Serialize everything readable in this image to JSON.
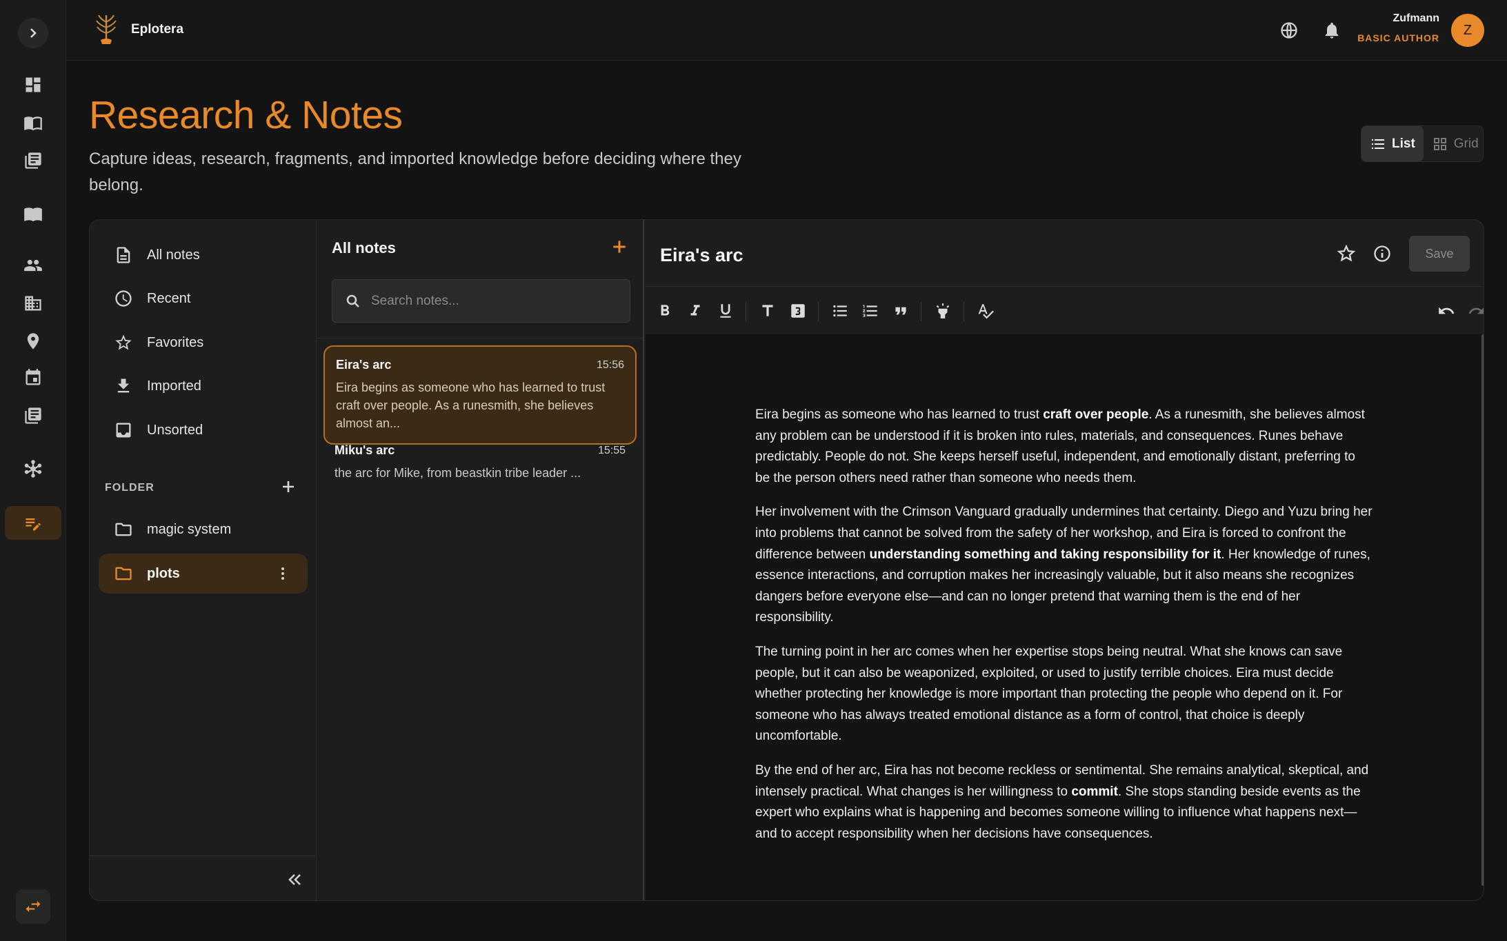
{
  "app": {
    "name": "Eplotera"
  },
  "header": {
    "user_name": "Zufmann",
    "user_role": "BASIC AUTHOR",
    "avatar_initial": "Z"
  },
  "page": {
    "title": "Research & Notes",
    "subtitle": "Capture ideas, research, fragments, and imported knowledge before deciding where they belong."
  },
  "view_toggle": {
    "list_label": "List",
    "grid_label": "Grid",
    "selected": "List"
  },
  "nav": {
    "items": [
      {
        "label": "All notes",
        "icon": "document-icon"
      },
      {
        "label": "Recent",
        "icon": "clock-icon"
      },
      {
        "label": "Favorites",
        "icon": "star-icon"
      },
      {
        "label": "Imported",
        "icon": "download-icon"
      },
      {
        "label": "Unsorted",
        "icon": "inbox-icon"
      }
    ],
    "folder_heading": "FOLDER",
    "folders": [
      {
        "label": "magic system"
      },
      {
        "label": "plots"
      }
    ]
  },
  "notes_list": {
    "title": "All notes",
    "search_placeholder": "Search notes...",
    "notes": [
      {
        "title": "Eira's arc",
        "time": "15:56",
        "preview": "Eira begins as someone who has learned to trust craft over people. As a runesmith, she believes almost an..."
      },
      {
        "title": "Miku's arc",
        "time": "15:55",
        "preview": "the arc for Mike, from beastkin tribe leader ..."
      }
    ]
  },
  "editor": {
    "title": "Eira's arc",
    "save_label": "Save",
    "paragraphs": [
      {
        "parts": [
          {
            "t": "Eira begins as someone who has learned to trust "
          },
          {
            "t": "craft over people",
            "b": true
          },
          {
            "t": ". As a runesmith, she believes almost any problem can be understood if it is broken into rules, materials, and consequences. Runes behave predictably. People do not. She keeps herself useful, independent, and emotionally distant, preferring to be the person others need rather than someone who needs them."
          }
        ]
      },
      {
        "parts": [
          {
            "t": "Her involvement with the Crimson Vanguard gradually undermines that certainty. Diego and Yuzu bring her into problems that cannot be solved from the safety of her workshop, and Eira is forced to confront the difference between "
          },
          {
            "t": "understanding something and taking responsibility for it",
            "b": true
          },
          {
            "t": ". Her knowledge of runes, essence interactions, and corruption makes her increasingly valuable, but it also means she recognizes dangers before everyone else—and can no longer pretend that warning them is the end of her responsibility."
          }
        ]
      },
      {
        "parts": [
          {
            "t": "The turning point in her arc comes when her expertise stops being neutral. What she knows can save people, but it can also be weaponized, exploited, or used to justify terrible choices. Eira must decide whether protecting her knowledge is more important than protecting the people who depend on it. For someone who has always treated emotional distance as a form of control, that choice is deeply uncomfortable."
          }
        ]
      },
      {
        "parts": [
          {
            "t": "By the end of her arc, Eira has not become reckless or sentimental. She remains analytical, skeptical, and intensely practical. What changes is her willingness to "
          },
          {
            "t": "commit",
            "b": true
          },
          {
            "t": ". She stops standing beside events as the expert who explains what is happening and becomes someone willing to influence what happens next—and to accept responsibility when her decisions have consequences."
          }
        ]
      }
    ]
  },
  "colors": {
    "accent": "#e8892a",
    "background": "#131313",
    "panel": "#1d1d1d",
    "danger": "#e0483a"
  }
}
